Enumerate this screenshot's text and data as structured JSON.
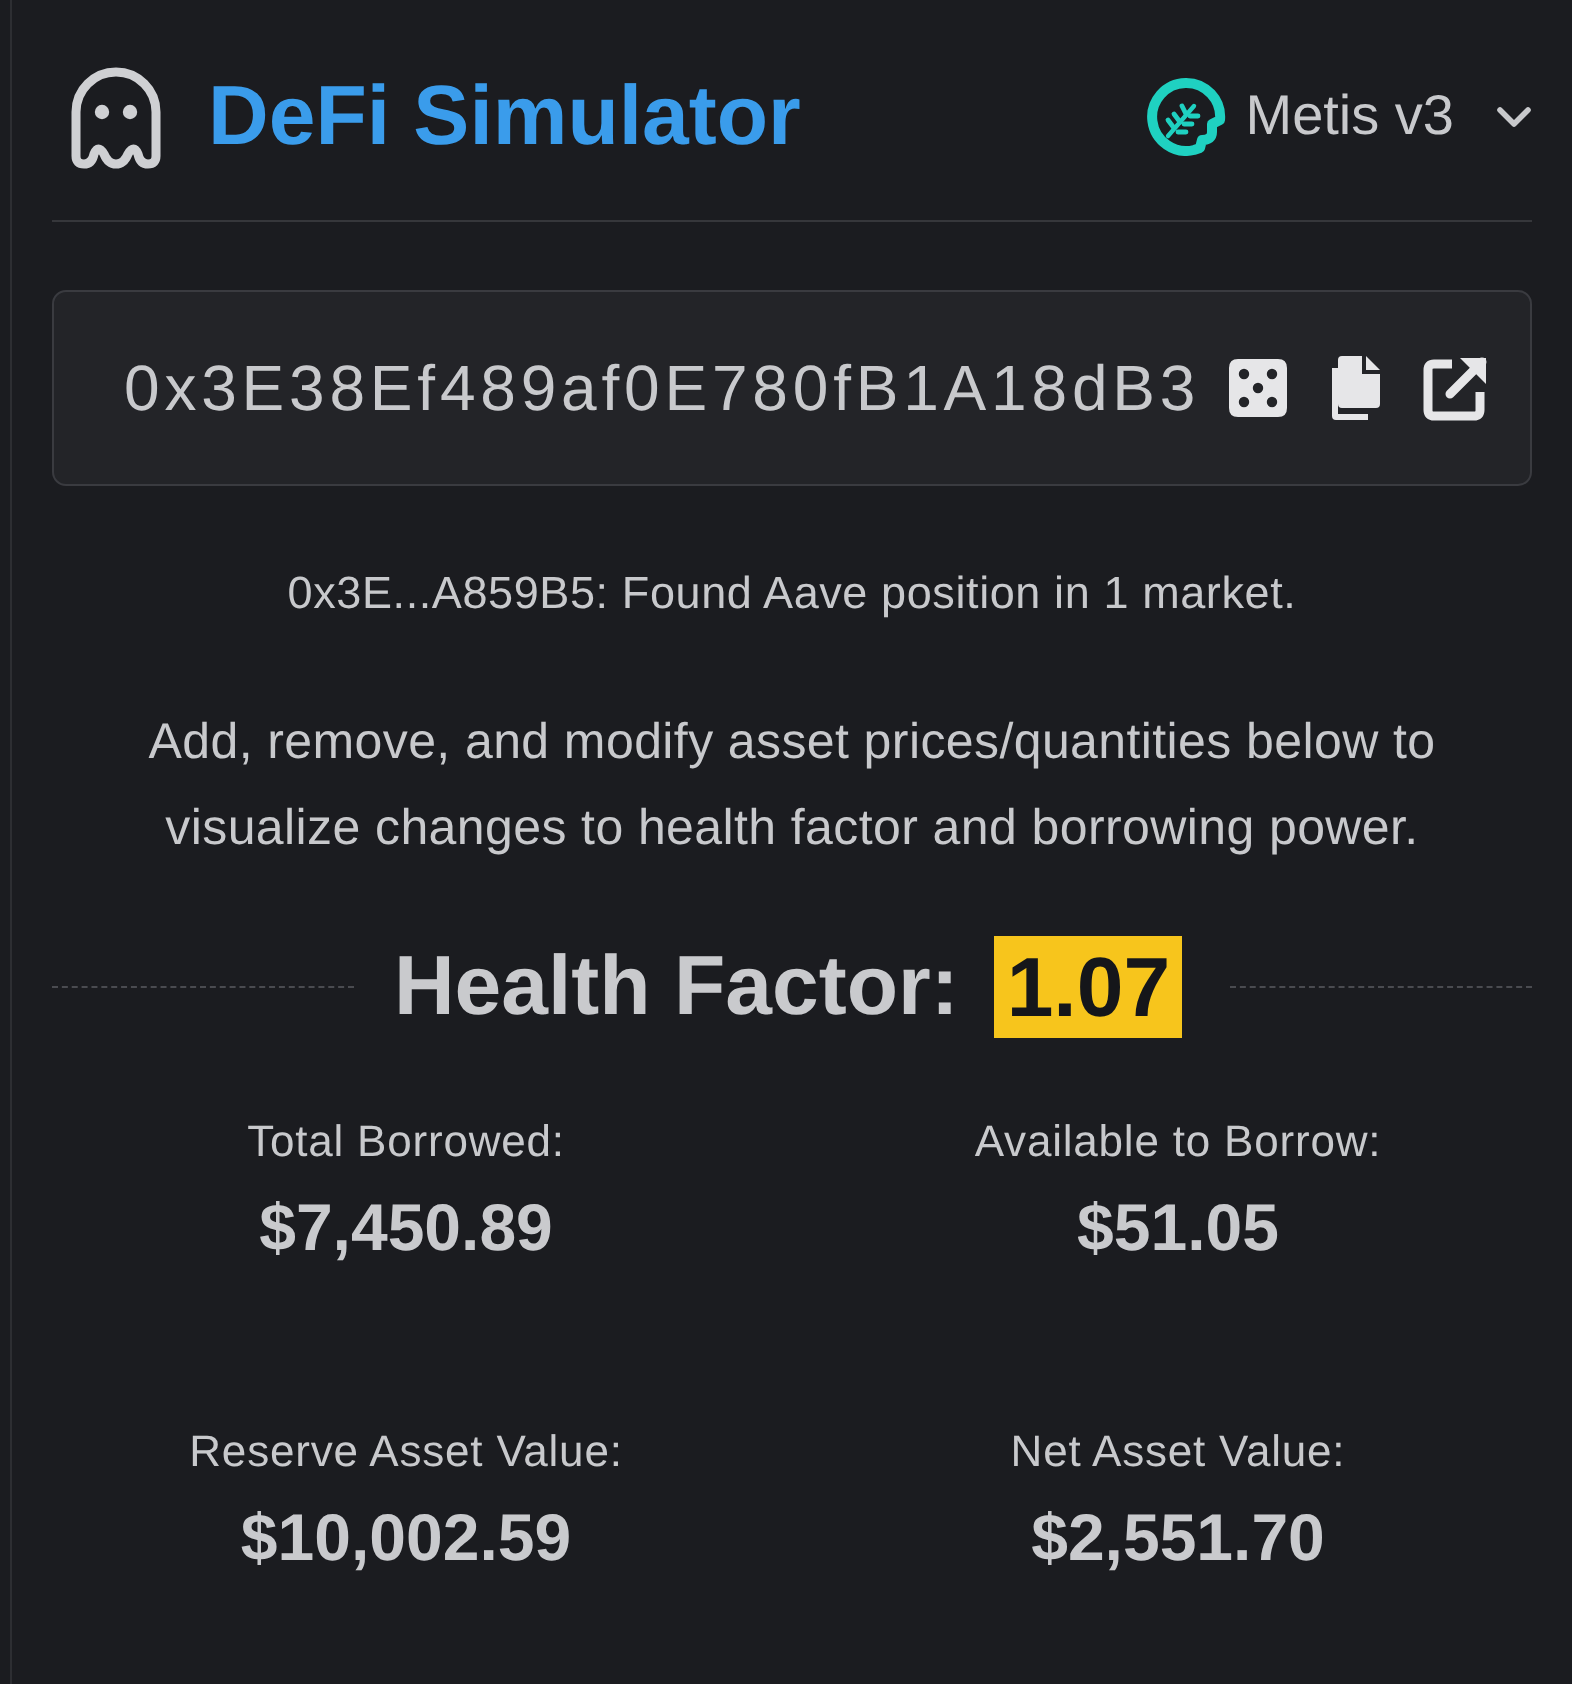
{
  "header": {
    "title": "DeFi Simulator",
    "market": {
      "label": "Metis v3"
    }
  },
  "address_field": {
    "value": "0x3E38Ef489af0E780fB1A18dB3"
  },
  "status": "0x3E...A859B5: Found Aave position in 1 market.",
  "instructions": "Add, remove, and modify asset prices/quantities below to visualize changes to health factor and borrowing power.",
  "health_factor": {
    "label": "Health Factor:",
    "value": "1.07"
  },
  "stats": [
    {
      "label": "Total Borrowed:",
      "value": "$7,450.89"
    },
    {
      "label": "Available to Borrow:",
      "value": "$51.05"
    },
    {
      "label": "Reserve Asset Value:",
      "value": "$10,002.59"
    },
    {
      "label": "Net Asset Value:",
      "value": "$2,551.70"
    }
  ]
}
